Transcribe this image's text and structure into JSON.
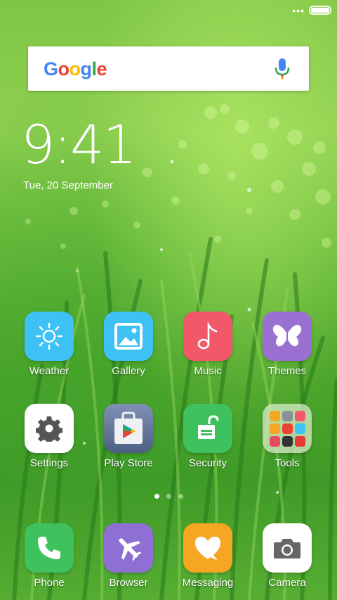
{
  "status": {
    "dots": "•••",
    "battery_level": 1.0
  },
  "search": {
    "logo": [
      "G",
      "o",
      "o",
      "g",
      "l",
      "e"
    ],
    "logo_colors": [
      "#4285F4",
      "#EA4335",
      "#FBBC05",
      "#4285F4",
      "#34A853",
      "#EA4335"
    ]
  },
  "clock": {
    "time": "9:41",
    "date": "Tue, 20 September"
  },
  "apps_row1": [
    {
      "label": "Weather",
      "icon": "sun-icon",
      "color": "#3ec2f5"
    },
    {
      "label": "Gallery",
      "icon": "picture-icon",
      "color": "#3ec2f5"
    },
    {
      "label": "Music",
      "icon": "music-note-icon",
      "color": "#f3586a"
    },
    {
      "label": "Themes",
      "icon": "butterfly-icon",
      "color": "#9a71d2"
    }
  ],
  "apps_row2": [
    {
      "label": "Settings",
      "icon": "gear-icon",
      "color": "#ffffff"
    },
    {
      "label": "Play Store",
      "icon": "play-store-icon",
      "color": "#5b6f93"
    },
    {
      "label": "Security",
      "icon": "unlock-icon",
      "color": "#3fc25d"
    },
    {
      "label": "Tools",
      "icon": "folder-icon",
      "color": "#d7ebc8"
    }
  ],
  "pager": {
    "pages": 3,
    "active": 0
  },
  "dock": [
    {
      "label": "Phone",
      "icon": "phone-icon",
      "color": "#3fc25d"
    },
    {
      "label": "Browser",
      "icon": "airplane-icon",
      "color": "#8e6fd4"
    },
    {
      "label": "Messaging",
      "icon": "heart-chat-icon",
      "color": "#f6a623"
    },
    {
      "label": "Camera",
      "icon": "camera-icon",
      "color": "#ffffff"
    }
  ]
}
